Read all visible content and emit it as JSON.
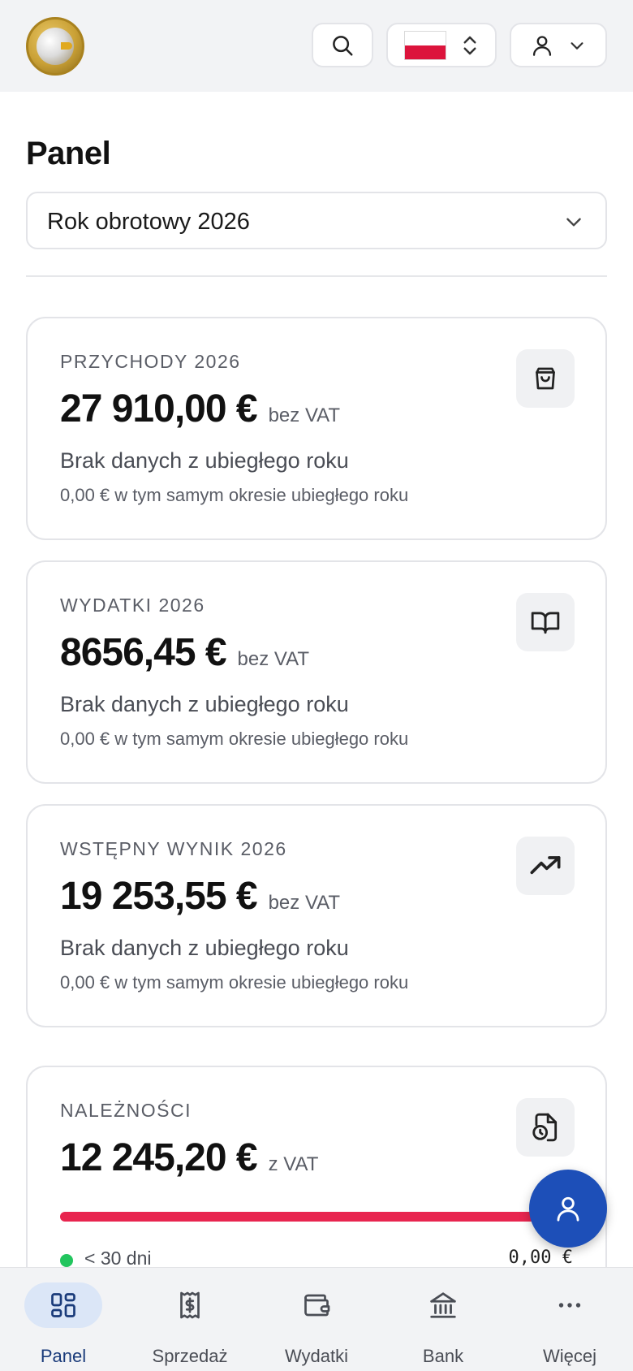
{
  "header": {
    "search_icon": "search-icon",
    "language_flag": "poland-flag",
    "user_icon": "user-icon"
  },
  "main": {
    "title": "Panel",
    "fiscal_year_select": "Rok obrotowy 2026"
  },
  "cards": [
    {
      "label": "PRZYCHODY 2026",
      "value": "27 910,00 €",
      "suffix": "bez VAT",
      "note": "Brak danych z ubiegłego roku",
      "sub": "0,00 € w tym samym okresie ubiegłego roku",
      "icon": "shopping-bag-icon"
    },
    {
      "label": "WYDATKI 2026",
      "value": "8656,45 €",
      "suffix": "bez VAT",
      "note": "Brak danych z ubiegłego roku",
      "sub": "0,00 € w tym samym okresie ubiegłego roku",
      "icon": "book-open-icon"
    },
    {
      "label": "WSTĘPNY WYNIK 2026",
      "value": "19 253,55 €",
      "suffix": "bez VAT",
      "note": "Brak danych z ubiegłego roku",
      "sub": "0,00 € w tym samym okresie ubiegłego roku",
      "icon": "trending-up-icon"
    }
  ],
  "receivables": {
    "label": "NALEŻNOŚCI",
    "value": "12 245,20 €",
    "suffix": "z VAT",
    "icon": "file-clock-icon",
    "progress_fraction": 1.0,
    "progress_color": "#e8254f",
    "buckets": [
      {
        "label": "< 30 dni",
        "value": "0,00 €",
        "dot_color": "#22c55e"
      }
    ]
  },
  "fab": {
    "icon": "user-icon"
  },
  "bottom_nav": [
    {
      "label": "Panel",
      "icon": "dashboard-icon",
      "active": true
    },
    {
      "label": "Sprzedaż",
      "icon": "receipt-dollar-icon",
      "active": false
    },
    {
      "label": "Wydatki",
      "icon": "wallet-icon",
      "active": false
    },
    {
      "label": "Bank",
      "icon": "bank-icon",
      "active": false
    },
    {
      "label": "Więcej",
      "icon": "more-horizontal-icon",
      "active": false
    }
  ],
  "colors": {
    "accent": "#1d4fb8",
    "nav_active_bg": "#dbe6f7",
    "danger": "#e8254f",
    "success": "#22c55e"
  }
}
